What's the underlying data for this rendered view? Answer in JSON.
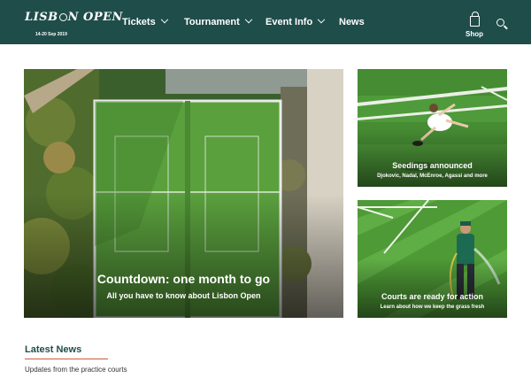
{
  "brand": {
    "logo_text_left": "LISB",
    "logo_text_right": "N OPEN",
    "dates": "14-20 Sep 2019"
  },
  "nav": {
    "items": [
      {
        "label": "Tickets",
        "has_dropdown": true
      },
      {
        "label": "Tournament",
        "has_dropdown": true
      },
      {
        "label": "Event Info",
        "has_dropdown": true
      },
      {
        "label": "News",
        "has_dropdown": false
      }
    ],
    "shop_label": "Shop",
    "icons": {
      "shop": "shopping-bag-icon",
      "search": "search-icon"
    }
  },
  "cards": [
    {
      "title": "Countdown: one month to go",
      "subtitle": "All you have to know about Lisbon Open",
      "image": "aerial-tennis-court"
    },
    {
      "title": "Seedings announced",
      "subtitle": "Djokovic, Nadal, McEnroe, Agassi and more",
      "image": "tennis-player-diving"
    },
    {
      "title": "Courts are ready for action",
      "subtitle": "Learn about how we keep the grass fresh",
      "image": "groundskeeper-watering-grass"
    }
  ],
  "latest_news": {
    "heading": "Latest News",
    "items": [
      "Updates from the practice courts"
    ]
  },
  "colors": {
    "header_bg": "#1f4d4a",
    "accent": "#cf5a3f",
    "grass": "#4f9a3a"
  }
}
